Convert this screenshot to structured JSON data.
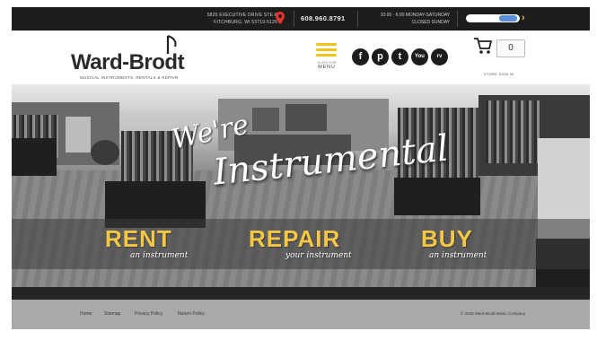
{
  "topbar": {
    "address_line1": "5825 EXECUTIVE DRIVE STE A",
    "address_line2": "FITCHBURG, WI 53719-5126",
    "phone": "608.960.8791",
    "hours_line1": "10:00 - 6:00 MONDAY-SATURDAY",
    "hours_line2": "CLOSED SUNDAY",
    "search_placeholder": "",
    "location_icon": "map-pin-icon",
    "search_arrow_icon": "chevron-right-icon"
  },
  "header": {
    "logo_text": "Ward-Brodt",
    "logo_subtitle": "MUSICAL INSTRUMENTS, RENTALS & REPAIR",
    "menu_click": "CLICK FOR",
    "menu_label": "MENU",
    "social": [
      {
        "icon": "facebook-icon",
        "glyph": "f"
      },
      {
        "icon": "pinterest-icon",
        "glyph": "p"
      },
      {
        "icon": "tumblr-icon",
        "glyph": "t"
      },
      {
        "icon": "youtube-icon",
        "glyph": "You"
      },
      {
        "icon": "reverb-icon",
        "glyph": "rv"
      }
    ],
    "cart_count": "0",
    "cart_label": "STORE SIGN IN"
  },
  "hero": {
    "tagline_top": "We're",
    "tagline_main": "Instrumental",
    "ctas": [
      {
        "word": "RENT",
        "sub": "an instrument"
      },
      {
        "word": "REPAIR",
        "sub": "your instrument"
      },
      {
        "word": "BUY",
        "sub": "an instrument"
      }
    ],
    "accent_color": "#f6c744"
  },
  "footer": {
    "links": [
      "Home",
      "Sitemap",
      "Privacy Policy",
      "Return Policy"
    ],
    "copyright": "© 2016 Ward-Brodt Music Company"
  }
}
